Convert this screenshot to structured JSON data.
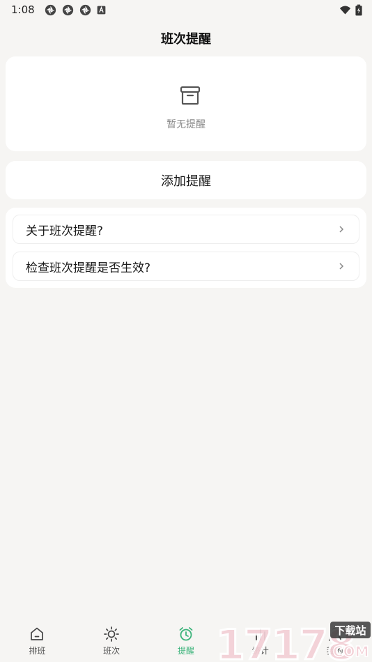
{
  "status_bar": {
    "time": "1:08",
    "app_icons": [
      "aperture-icon",
      "aperture-icon",
      "aperture-icon",
      "a-icon"
    ],
    "right_icons": [
      "wifi-icon",
      "battery-icon"
    ]
  },
  "header": {
    "title": "班次提醒"
  },
  "empty_state": {
    "icon": "archive-icon",
    "text": "暂无提醒"
  },
  "add_button": {
    "label": "添加提醒"
  },
  "faq": {
    "items": [
      {
        "label": "关于班次提醒?"
      },
      {
        "label": "检查班次提醒是否生效?"
      }
    ]
  },
  "bottom_nav": {
    "items": [
      {
        "label": "排班",
        "icon": "home-icon",
        "active": false
      },
      {
        "label": "班次",
        "icon": "sun-icon",
        "active": false
      },
      {
        "label": "提醒",
        "icon": "alarm-clock-icon",
        "active": true
      },
      {
        "label": "统计",
        "icon": "bar-chart-icon",
        "active": false
      },
      {
        "label": "我的",
        "icon": "user-icon",
        "active": false
      }
    ]
  },
  "watermark": {
    "text": "17178",
    "badge": "下载站",
    "domain": "COM"
  },
  "colors": {
    "accent": "#3bb37a",
    "background": "#f6f5f3",
    "card": "#ffffff",
    "muted_text": "#8a8a8a"
  }
}
